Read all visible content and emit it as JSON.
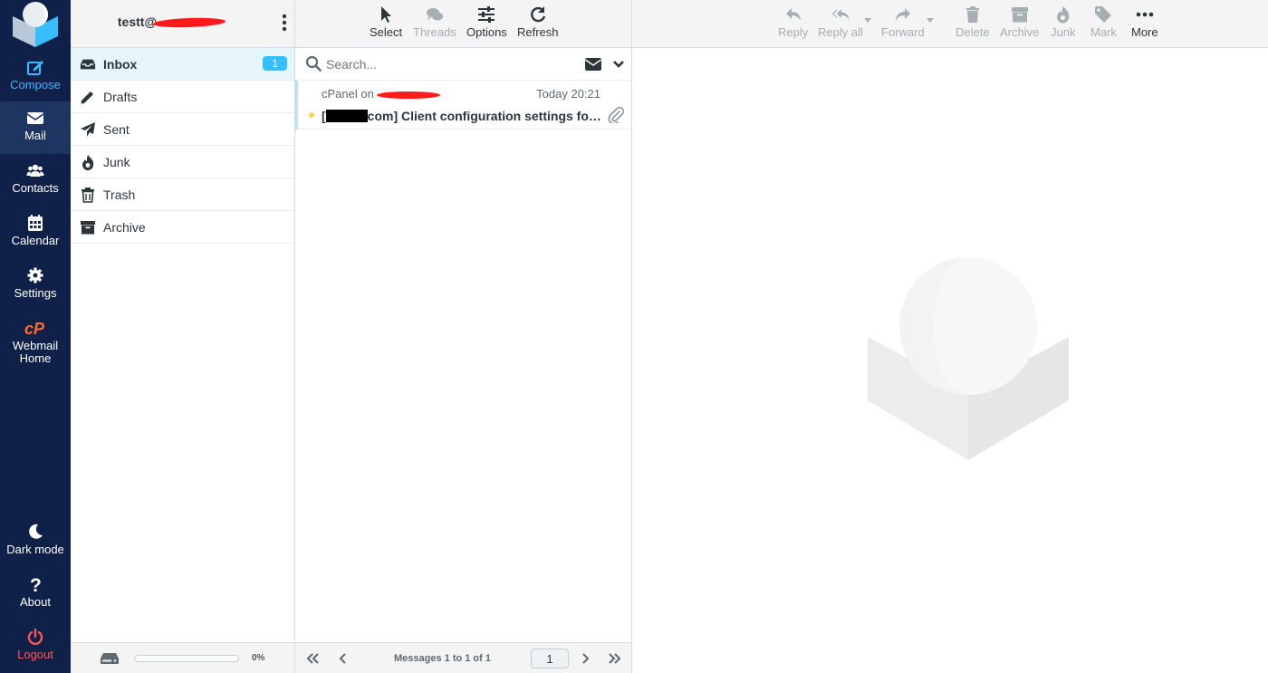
{
  "rail": {
    "compose": "Compose",
    "mail": "Mail",
    "contacts": "Contacts",
    "calendar": "Calendar",
    "settings": "Settings",
    "webmail_home": "Webmail Home",
    "dark_mode": "Dark mode",
    "about": "About",
    "logout": "Logout"
  },
  "header": {
    "user": "testt@"
  },
  "folders": [
    {
      "name": "Inbox",
      "count": "1",
      "icon": "inbox-icon"
    },
    {
      "name": "Drafts",
      "icon": "pencil-icon"
    },
    {
      "name": "Sent",
      "icon": "paper-plane-icon"
    },
    {
      "name": "Junk",
      "icon": "fire-icon"
    },
    {
      "name": "Trash",
      "icon": "trash-icon"
    },
    {
      "name": "Archive",
      "icon": "archive-box-icon"
    }
  ],
  "quota": {
    "text": "0%",
    "fraction": 0
  },
  "list_toolbar": {
    "select": "Select",
    "threads": "Threads",
    "options": "Options",
    "refresh": "Refresh"
  },
  "search": {
    "placeholder": "Search..."
  },
  "messages": [
    {
      "from": "cPanel on",
      "date": "Today 20:21",
      "subject_prefix": "[",
      "subject": "com] Client configuration settings for ..."
    }
  ],
  "pager": {
    "text": "Messages 1 to 1 of 1",
    "page": "1"
  },
  "content_toolbar": {
    "reply": "Reply",
    "reply_all": "Reply all",
    "forward": "Forward",
    "delete": "Delete",
    "archive": "Archive",
    "junk": "Junk",
    "mark": "Mark",
    "more": "More"
  },
  "colors": {
    "rail_bg": "#0f2148",
    "accent": "#37beff",
    "logout": "#ff5552",
    "unread": "#ffd452"
  }
}
